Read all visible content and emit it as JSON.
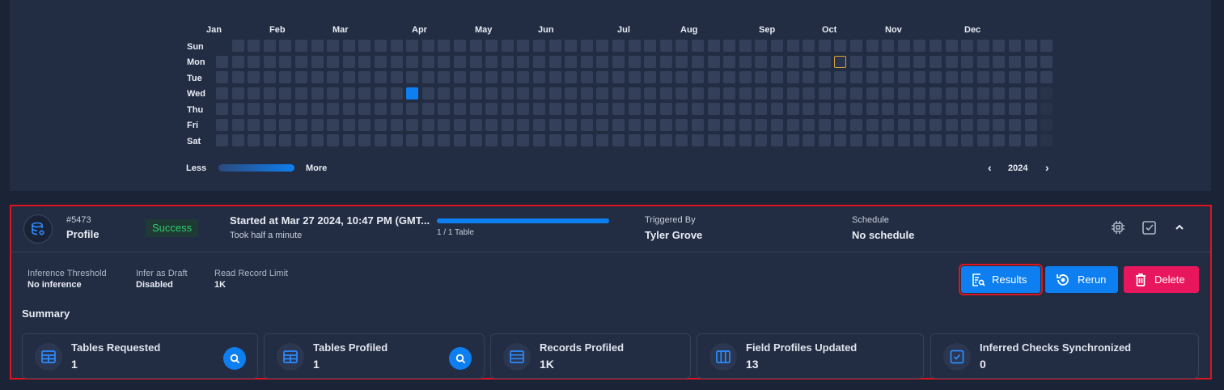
{
  "heatmap": {
    "months": [
      "Jan",
      "Feb",
      "Mar",
      "Apr",
      "May",
      "Jun",
      "Jul",
      "Aug",
      "Sep",
      "Oct",
      "Nov",
      "Dec"
    ],
    "days": [
      "Sun",
      "Mon",
      "Tue",
      "Wed",
      "Thu",
      "Fri",
      "Sat"
    ],
    "legend_less": "Less",
    "legend_more": "More",
    "year": "2024",
    "active_date": "2024-03-27",
    "highlighted_date": "2024-09-30",
    "colors": {
      "empty": "#34405a",
      "active": "#0d7ff0",
      "highlight": "#d9a23a"
    }
  },
  "run": {
    "id": "#5473",
    "type": "Profile",
    "status": "Success",
    "started": "Started at Mar 27 2024, 10:47 PM (GMT...",
    "took": "Took half a minute",
    "progress_label": "1 / 1 Table",
    "progress": 1.0,
    "triggered_by_label": "Triggered By",
    "triggered_by": "Tyler Grove",
    "schedule_label": "Schedule",
    "schedule": "No schedule",
    "meta": [
      {
        "label": "Inference Threshold",
        "value": "No inference"
      },
      {
        "label": "Infer as Draft",
        "value": "Disabled"
      },
      {
        "label": "Read Record Limit",
        "value": "1K"
      }
    ],
    "buttons": {
      "results": "Results",
      "rerun": "Rerun",
      "delete": "Delete"
    },
    "summary_title": "Summary",
    "stats": [
      {
        "label": "Tables Requested",
        "value": "1",
        "icon": "table-icon"
      },
      {
        "label": "Tables Profiled",
        "value": "1",
        "icon": "table-icon"
      },
      {
        "label": "Records Profiled",
        "value": "1K",
        "icon": "rows-icon"
      },
      {
        "label": "Field Profiles Updated",
        "value": "13",
        "icon": "columns-icon"
      },
      {
        "label": "Inferred Checks Synchronized",
        "value": "0",
        "icon": "check-square-icon"
      }
    ]
  },
  "colors": {
    "accent": "#0d7ff0",
    "danger": "#e8175d",
    "success": "#2ecc71",
    "panel": "#222d43",
    "background": "#1b2437"
  }
}
